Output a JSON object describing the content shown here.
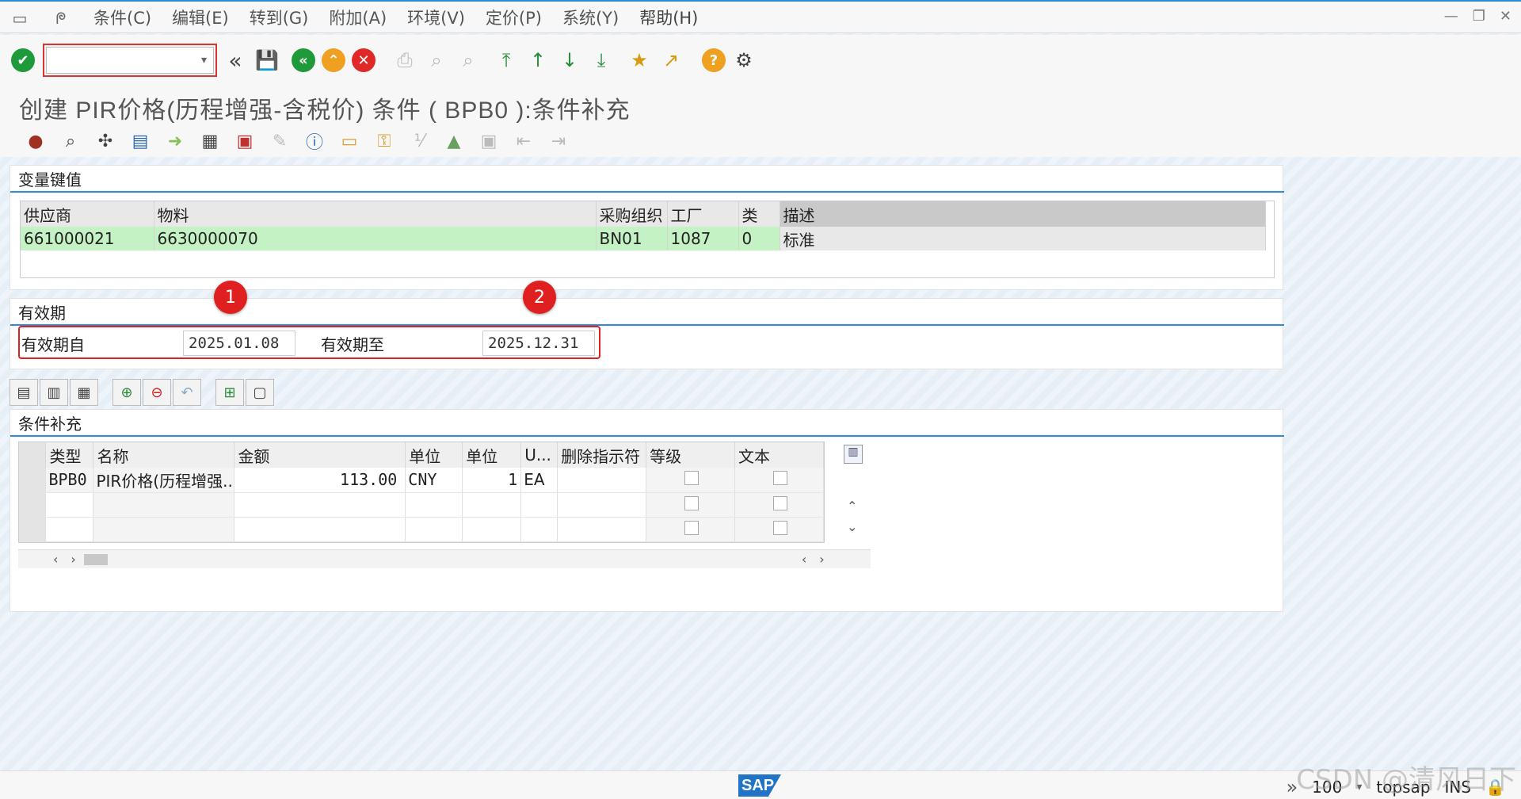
{
  "menubar": {
    "items": [
      "条件(C)",
      "编辑(E)",
      "转到(G)",
      "附加(A)",
      "环境(V)",
      "定价(P)",
      "系统(Y)",
      "帮助(H)"
    ]
  },
  "toolbar": {
    "command_value": ""
  },
  "title": "创建 PIR价格(历程增强-含税价) 条件 ( BPB0 ):条件补充",
  "variant_key": {
    "title": "变量键值",
    "headers": [
      "供应商",
      "物料",
      "采购组织",
      "工厂",
      "类",
      "描述"
    ],
    "row": [
      "661000021",
      "6630000070",
      "BN01",
      "1087",
      "0",
      "标准"
    ]
  },
  "validity": {
    "title": "有效期",
    "from_label": "有效期自",
    "from_value": "2025.01.08",
    "to_label": "有效期至",
    "to_value": "2025.12.31",
    "badge1": "1",
    "badge2": "2"
  },
  "supplements": {
    "title": "条件补充",
    "headers": [
      "类型",
      "名称",
      "金额",
      "单位",
      "单位",
      "U...",
      "删除指示符",
      "等级",
      "文本"
    ],
    "row": {
      "type": "BPB0",
      "name": "PIR价格(历程增强..",
      "amount": "113.00",
      "currency": "CNY",
      "per": "1",
      "uom": "EA"
    }
  },
  "statusbar": {
    "zoom": "100",
    "system": "topsap",
    "mode": "INS",
    "logo": "SAP"
  },
  "watermark": "CSDN @清风日下"
}
